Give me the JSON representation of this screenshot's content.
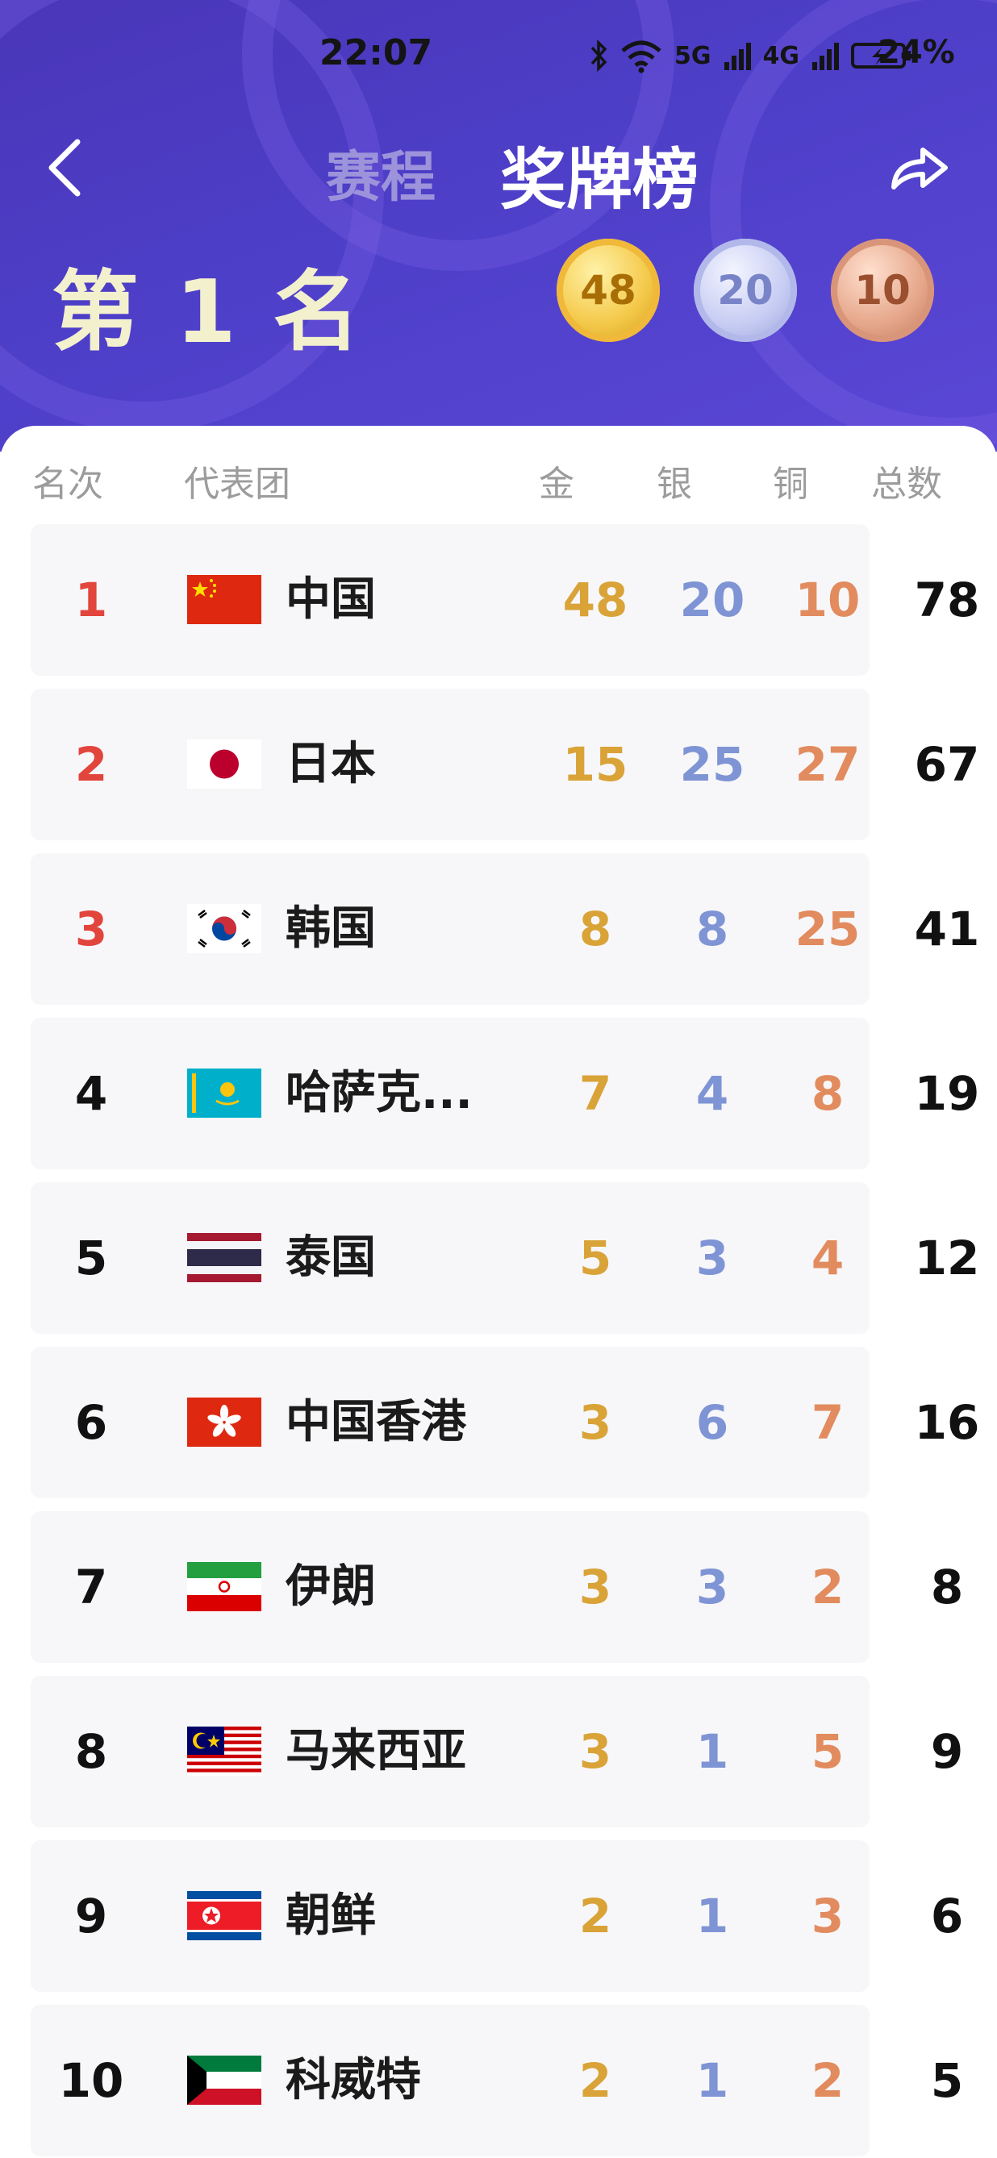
{
  "status_bar": {
    "time": "22:07",
    "battery": "24%",
    "network_labels": [
      "5G",
      "4G"
    ]
  },
  "nav": {
    "tab_schedule": "赛程",
    "tab_medals": "奖牌榜"
  },
  "summary": {
    "rank_label": "第 1 名",
    "gold": "48",
    "silver": "20",
    "bronze": "10"
  },
  "table": {
    "headers": {
      "rank": "名次",
      "team": "代表团",
      "gold": "金",
      "silver": "银",
      "bronze": "铜",
      "total": "总数"
    },
    "rows": [
      {
        "rank": "1",
        "name": "中国",
        "flag": "flag-china",
        "gold": "48",
        "silver": "20",
        "bronze": "10",
        "total": "78"
      },
      {
        "rank": "2",
        "name": "日本",
        "flag": "flag-japan",
        "gold": "15",
        "silver": "25",
        "bronze": "27",
        "total": "67"
      },
      {
        "rank": "3",
        "name": "韩国",
        "flag": "flag-south-korea",
        "gold": "8",
        "silver": "8",
        "bronze": "25",
        "total": "41"
      },
      {
        "rank": "4",
        "name": "哈萨克...",
        "flag": "flag-kazakhstan",
        "gold": "7",
        "silver": "4",
        "bronze": "8",
        "total": "19"
      },
      {
        "rank": "5",
        "name": "泰国",
        "flag": "flag-thailand",
        "gold": "5",
        "silver": "3",
        "bronze": "4",
        "total": "12"
      },
      {
        "rank": "6",
        "name": "中国香港",
        "flag": "flag-hong-kong",
        "gold": "3",
        "silver": "6",
        "bronze": "7",
        "total": "16"
      },
      {
        "rank": "7",
        "name": "伊朗",
        "flag": "flag-iran",
        "gold": "3",
        "silver": "3",
        "bronze": "2",
        "total": "8"
      },
      {
        "rank": "8",
        "name": "马来西亚",
        "flag": "flag-malaysia",
        "gold": "3",
        "silver": "1",
        "bronze": "5",
        "total": "9"
      },
      {
        "rank": "9",
        "name": "朝鲜",
        "flag": "flag-north-korea",
        "gold": "2",
        "silver": "1",
        "bronze": "3",
        "total": "6"
      },
      {
        "rank": "10",
        "name": "科威特",
        "flag": "flag-kuwait",
        "gold": "2",
        "silver": "1",
        "bronze": "2",
        "total": "5"
      }
    ]
  },
  "colors": {
    "gold": "#d9a338",
    "silver": "#7f94d4",
    "bronze": "#e28b5e",
    "top3_rank": "#e2453c",
    "header_bg": "#4d3fc8"
  }
}
